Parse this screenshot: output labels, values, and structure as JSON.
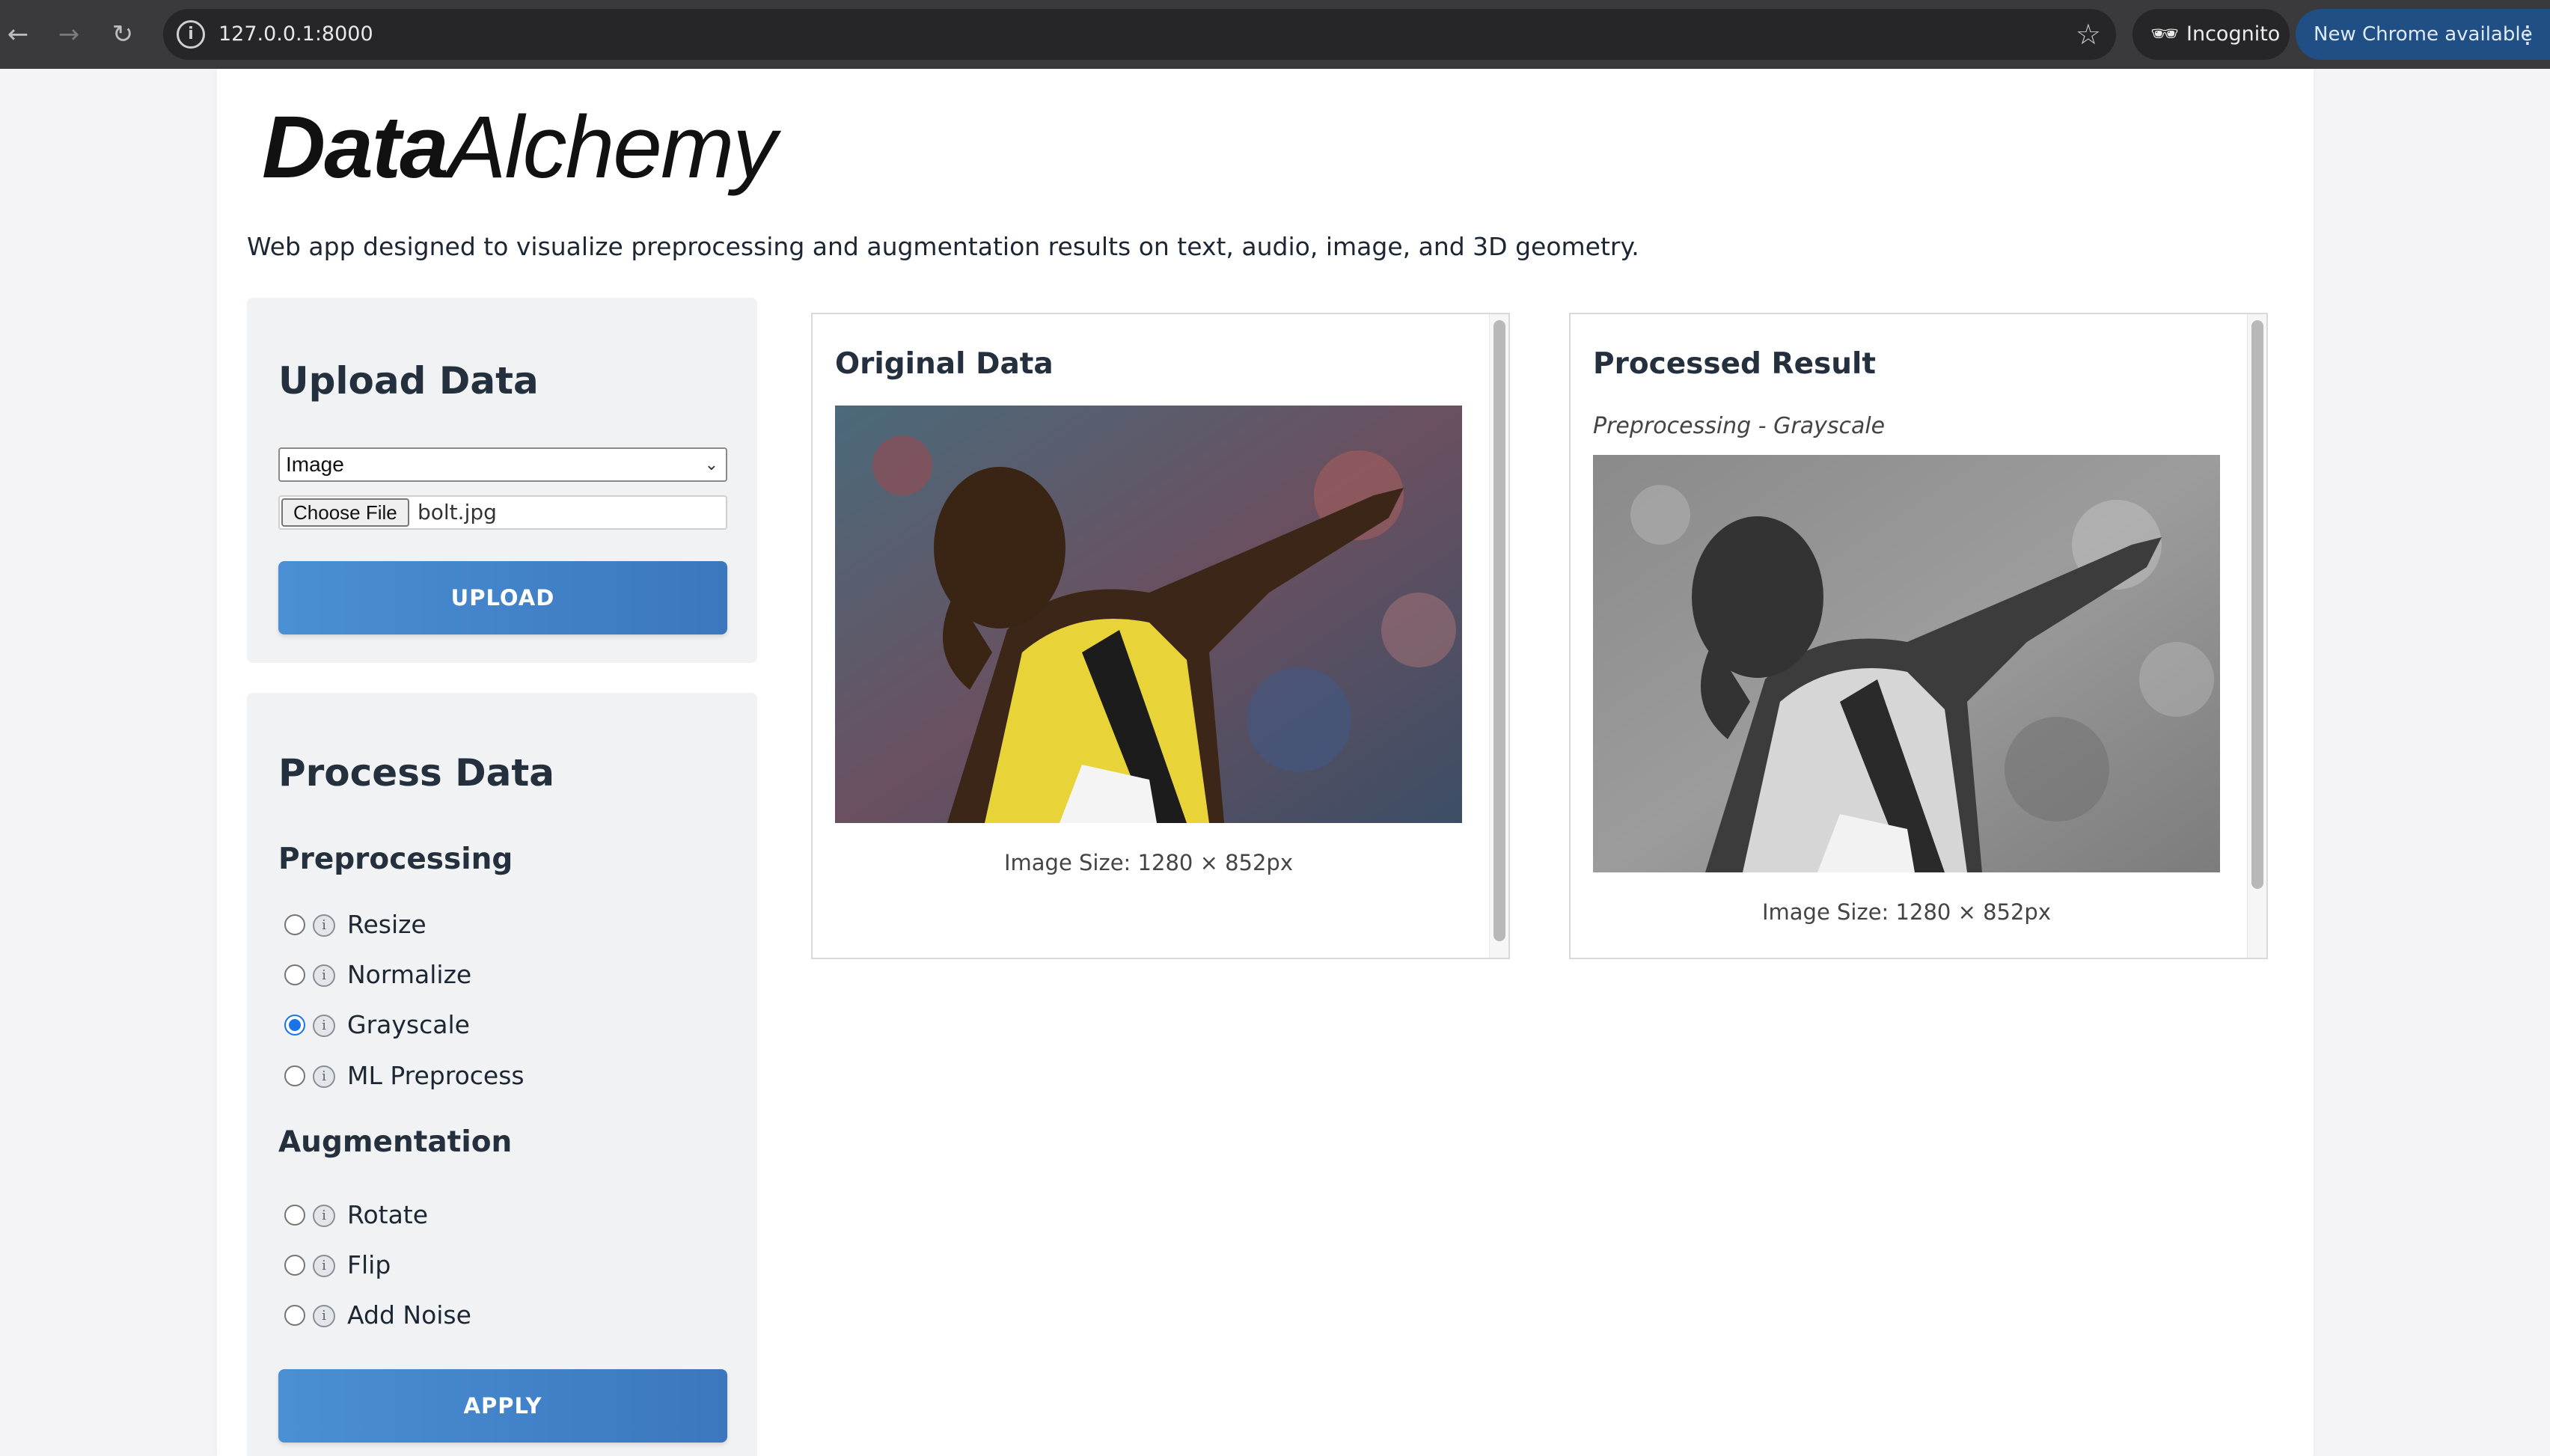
{
  "browser": {
    "url": "127.0.0.1:8000",
    "incognito_label": "Incognito",
    "update_label": "New Chrome available"
  },
  "brand": {
    "logo_bold": "Data",
    "logo_light": "Alchemy",
    "tagline": "Web app designed to visualize preprocessing and augmentation results on text, audio, image, and 3D geometry."
  },
  "upload": {
    "title": "Upload Data",
    "data_type": "Image",
    "choose_file_label": "Choose File",
    "file_name": "bolt.jpg",
    "button_label": "UPLOAD"
  },
  "process": {
    "title": "Process Data",
    "preprocessing_heading": "Preprocessing",
    "preprocessing_options": [
      {
        "label": "Resize",
        "checked": false
      },
      {
        "label": "Normalize",
        "checked": false
      },
      {
        "label": "Grayscale",
        "checked": true
      },
      {
        "label": "ML Preprocess",
        "checked": false
      }
    ],
    "augmentation_heading": "Augmentation",
    "augmentation_options": [
      {
        "label": "Rotate",
        "checked": false
      },
      {
        "label": "Flip",
        "checked": false
      },
      {
        "label": "Add Noise",
        "checked": false
      }
    ],
    "button_label": "APPLY"
  },
  "original": {
    "title": "Original Data",
    "size_text": "Image Size: 1280 × 852px"
  },
  "processed": {
    "title": "Processed Result",
    "caption": "Preprocessing - Grayscale",
    "size_text": "Image Size: 1280 × 852px"
  }
}
